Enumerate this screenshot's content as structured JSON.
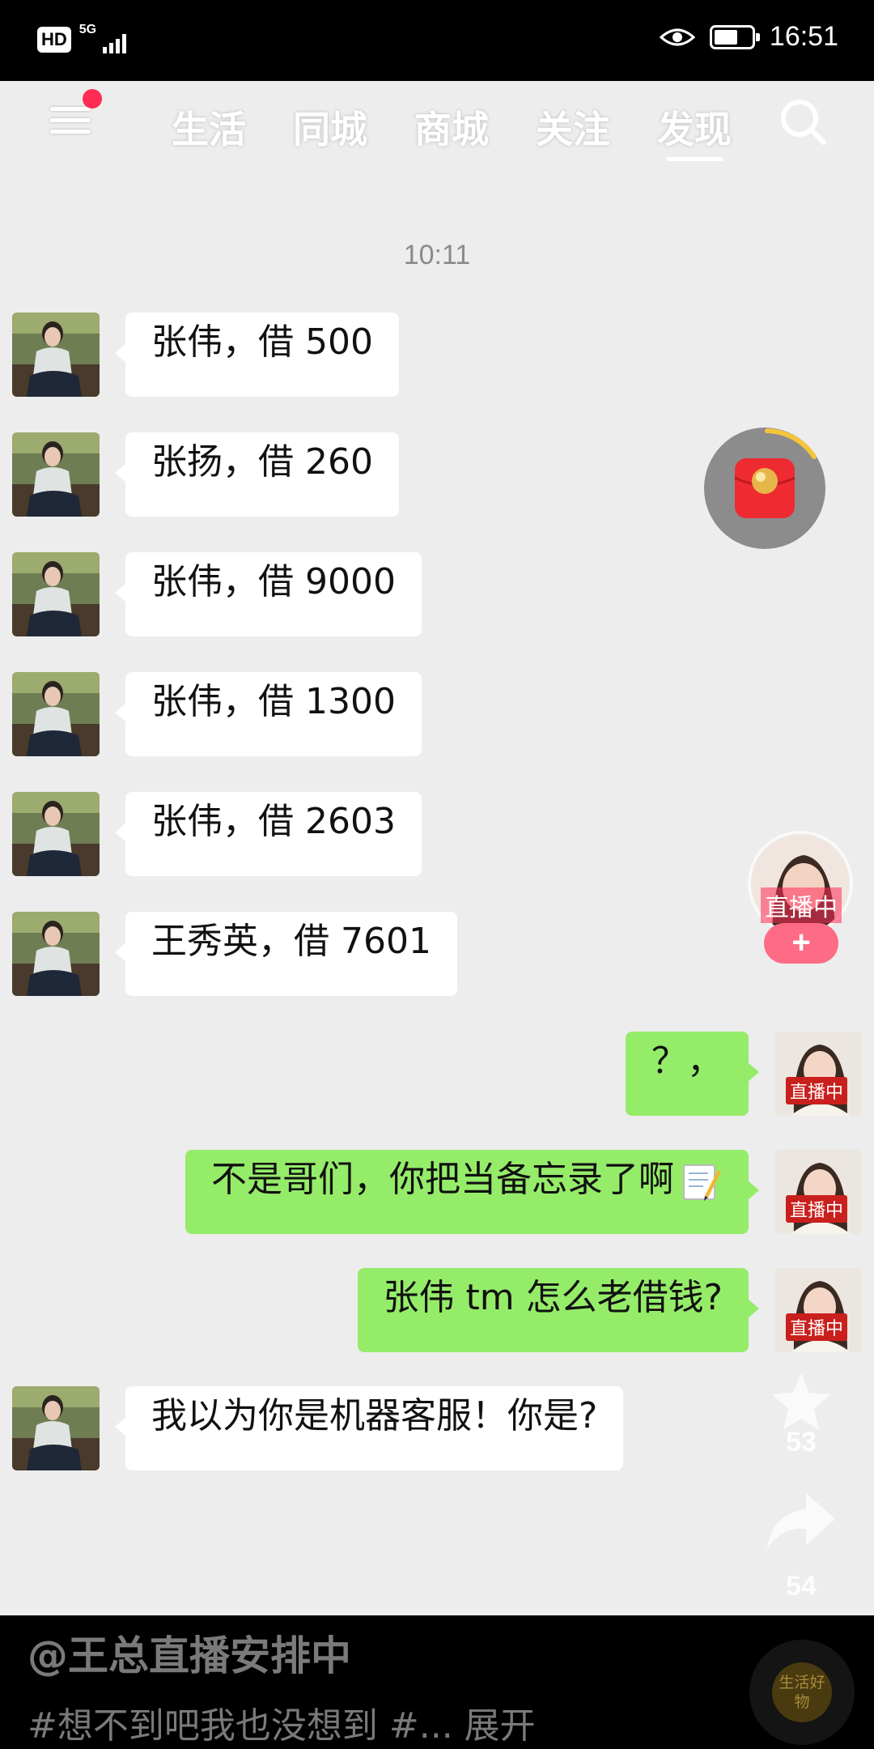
{
  "status_bar": {
    "hd_label": "HD",
    "network_label": "5G",
    "time": "16:51",
    "icons": [
      "eye-icon",
      "battery-icon",
      "signal-icon"
    ]
  },
  "nav": {
    "tabs": [
      {
        "label": "生活"
      },
      {
        "label": "同城"
      },
      {
        "label": "商城"
      },
      {
        "label": "关注"
      },
      {
        "label": "发现",
        "active": true
      }
    ],
    "icons": [
      "menu-icon",
      "search-icon"
    ],
    "notification_dot_color": "#fe2c55"
  },
  "chat": {
    "timestamp": "10:11",
    "messages": [
      {
        "side": "in",
        "text": "张伟，借 500"
      },
      {
        "side": "in",
        "text": "张扬，借 260"
      },
      {
        "side": "in",
        "text": "张伟，借 9000"
      },
      {
        "side": "in",
        "text": "张伟，借 1300"
      },
      {
        "side": "in",
        "text": "张伟，借 2603"
      },
      {
        "side": "in",
        "text": "王秀英，借 7601"
      },
      {
        "side": "out",
        "text": "？，",
        "avatar_tag": "直播中"
      },
      {
        "side": "out",
        "text": "不是哥们，你把当备忘录了啊",
        "emoji": "memo-icon",
        "avatar_tag": "直播中"
      },
      {
        "side": "out",
        "text": "张伟 tm 怎么老借钱?",
        "avatar_tag": "直播中"
      },
      {
        "side": "in",
        "text": "我以为你是机器客服！你是?"
      }
    ],
    "bubble_colors": {
      "incoming": "#ffffff",
      "outgoing": "#95ec69"
    }
  },
  "side_actions": {
    "red_packet_icon": "red-packet-icon",
    "live_label": "直播中",
    "follow_label": "+",
    "comment_count": "53",
    "share_count": "54",
    "icons": [
      "star-icon",
      "share-icon"
    ]
  },
  "caption": {
    "author": "@王总直播安排中",
    "description": "#想不到吧我也没想到 #... 展开",
    "mall_badge": "生活好物"
  }
}
